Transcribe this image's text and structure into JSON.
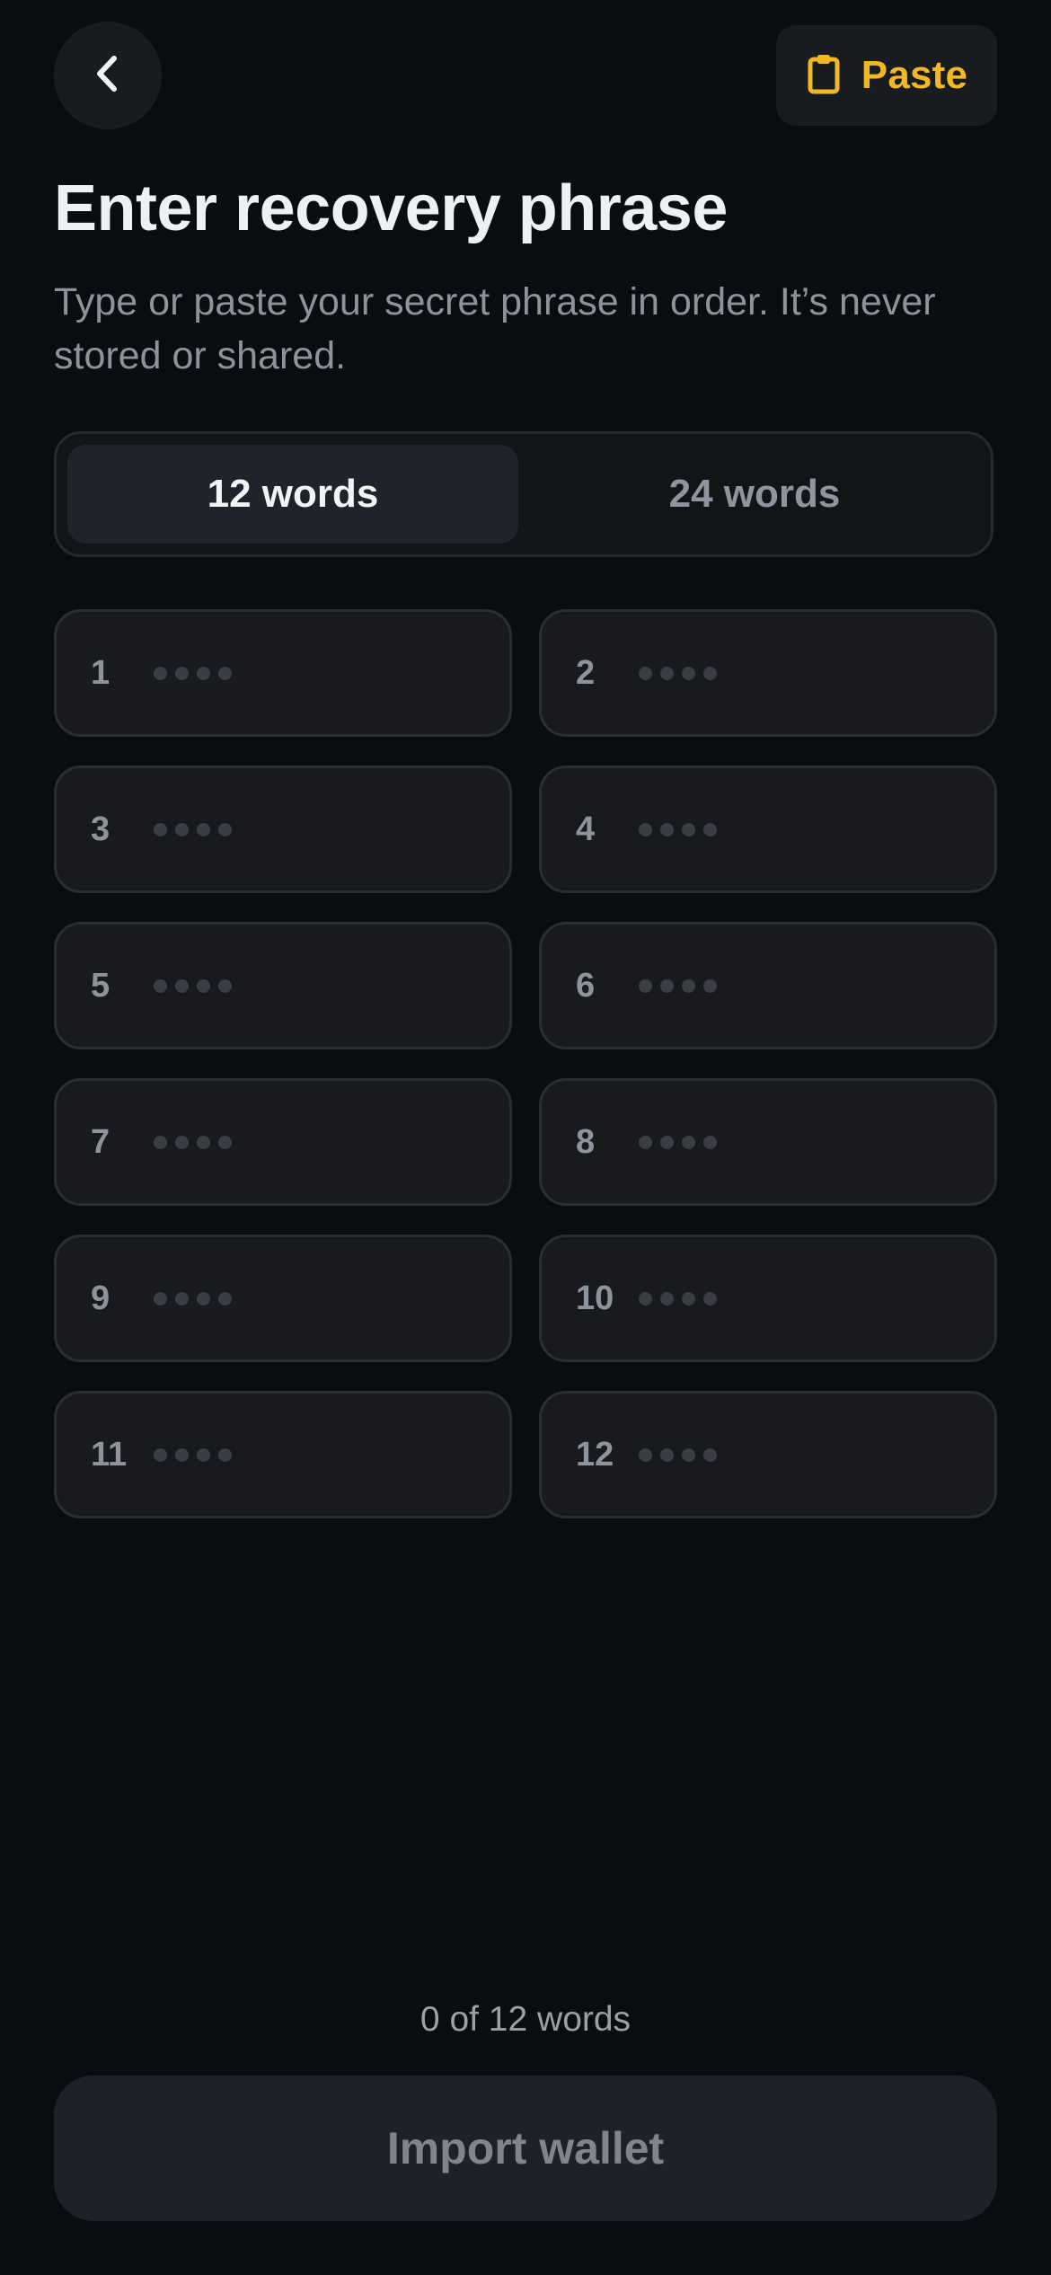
{
  "header": {
    "back_icon": "chevron-left-icon",
    "paste_icon": "clipboard-icon",
    "paste_label": "Paste"
  },
  "title": "Enter recovery phrase",
  "subtitle": "Type or paste your secret phrase in order. It’s never stored or shared.",
  "word_count_tabs": [
    {
      "label": "12 words",
      "active": true
    },
    {
      "label": "24 words",
      "active": false
    }
  ],
  "word_fields": [
    {
      "number": "1",
      "placeholder": "••••"
    },
    {
      "number": "2",
      "placeholder": "••••"
    },
    {
      "number": "3",
      "placeholder": "••••"
    },
    {
      "number": "4",
      "placeholder": "••••"
    },
    {
      "number": "5",
      "placeholder": "••••"
    },
    {
      "number": "6",
      "placeholder": "••••"
    },
    {
      "number": "7",
      "placeholder": "••••"
    },
    {
      "number": "8",
      "placeholder": "••••"
    },
    {
      "number": "9",
      "placeholder": "••••"
    },
    {
      "number": "10",
      "placeholder": "••••"
    },
    {
      "number": "11",
      "placeholder": "••••"
    },
    {
      "number": "12",
      "placeholder": "••••"
    }
  ],
  "counter": "0 of 12 words",
  "import_button": "Import wallet",
  "colors": {
    "background": "#0a0d10",
    "accent": "#f2b824",
    "field_bg": "#181a1e",
    "field_border": "#2a2d32",
    "muted_text": "#8e949b"
  }
}
